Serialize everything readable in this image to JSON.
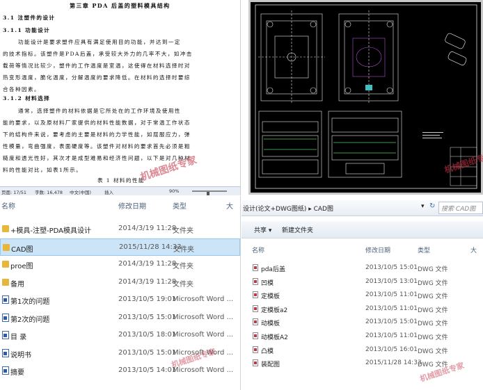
{
  "document": {
    "chapter": "第三章  PDA 后盖的塑料模具结构",
    "h1": "3.1 注塑件的设计",
    "h2": "3.1.1 功能设计",
    "para1": [
      "功能设计是要求塑件应具有满足使用目的功能，并达到一定",
      "的技术指标。该塑件是PDA后盖，承受较大外力的几率不大，如冲击",
      "载荷等情况比较少，塑件的工作温度是室温，这使得在材料选择时对",
      "热变形温度，脆化温度，分解温度的要求降低。在材料的选择时要综",
      "合各种因素。"
    ],
    "h3": "3.1.2 材料选择",
    "para2": [
      "通常，选择塑件的材料依据是它所处在的工作环境及使用性",
      "能的要求，以及原材料厂家提供的材料性能数据，对于常温工作状态",
      "下的结构件来说，要考虑的主要是材料的力学性能，如屈服应力，弹",
      "性模量，弯曲强度，表面硬度等。该塑件对材料的要求首先必须是粗",
      "糙度和透光性好，其次才是成型难易和经济性问题，以下是对几种材",
      "料的性能对比，如表1所示。"
    ],
    "table_caption": "表 1      材料的性能",
    "status": {
      "page": "页面: 17/51",
      "words": "字数: 16,478",
      "lang": "中文(中国)",
      "mode": "插入",
      "zoom": "90%"
    }
  },
  "watermark": "机械图纸专家",
  "explorer_left": {
    "columns": [
      "名称",
      "修改日期",
      "类型",
      "大"
    ],
    "rows": [
      {
        "name": "+模具-注塑-PDA模具设计",
        "date": "2014/3/19 11:28",
        "type": "文件夹",
        "icon": "folder-icon"
      },
      {
        "name": "CAD图",
        "date": "2015/11/28 14:33",
        "type": "文件夹",
        "icon": "folder-icon",
        "selected": true
      },
      {
        "name": "proe图",
        "date": "2014/3/19 11:28",
        "type": "文件夹",
        "icon": "folder-icon"
      },
      {
        "name": "备用",
        "date": "2014/3/19 11:28",
        "type": "文件夹",
        "icon": "folder-icon"
      },
      {
        "name": "第1次的问题",
        "date": "2013/10/5 19:01",
        "type": "Microsoft Word ...",
        "icon": "word-document-icon"
      },
      {
        "name": "第2次的问题",
        "date": "2013/10/5 15:01",
        "type": "Microsoft Word ...",
        "icon": "word-document-icon"
      },
      {
        "name": "目 录",
        "date": "2013/10/5 18:01",
        "type": "Microsoft Word ...",
        "icon": "word-document-icon"
      },
      {
        "name": "说明书",
        "date": "2013/10/5 15:01",
        "type": "Microsoft Word ...",
        "icon": "word-document-icon"
      },
      {
        "name": "摘要",
        "date": "2013/10/5 14:01",
        "type": "Microsoft Word ...",
        "icon": "word-document-icon"
      }
    ]
  },
  "explorer_right": {
    "breadcrumb": "设计(论文+DWG图纸) ▸ CAD图",
    "search_placeholder": "搜索 CAD图",
    "toolbar": {
      "share": "共享 ▾",
      "new_folder": "新建文件夹"
    },
    "columns": [
      "名称",
      "修改日期",
      "类型",
      "大"
    ],
    "rows": [
      {
        "name": "pda后盖",
        "date": "2013/10/5 15:01",
        "type": "DWG 文件"
      },
      {
        "name": "凹模",
        "date": "2013/10/5 13:01",
        "type": "DWG 文件"
      },
      {
        "name": "定模板",
        "date": "2013/10/5 11:01",
        "type": "DWG 文件"
      },
      {
        "name": "定模板a2",
        "date": "2013/10/5 11:01",
        "type": "DWG 文件"
      },
      {
        "name": "动模板",
        "date": "2013/10/5 15:01",
        "type": "DWG 文件"
      },
      {
        "name": "动模板A2",
        "date": "2013/10/5 11:01",
        "type": "DWG 文件"
      },
      {
        "name": "凸模",
        "date": "2013/10/5 16:01",
        "type": "DWG 文件"
      },
      {
        "name": "装配图",
        "date": "2015/11/28 14:33",
        "type": "DWG 文件"
      }
    ]
  },
  "colors": {
    "selection": "#cce4f7",
    "cad_bg": "#000000",
    "header_text": "#4c607a"
  }
}
